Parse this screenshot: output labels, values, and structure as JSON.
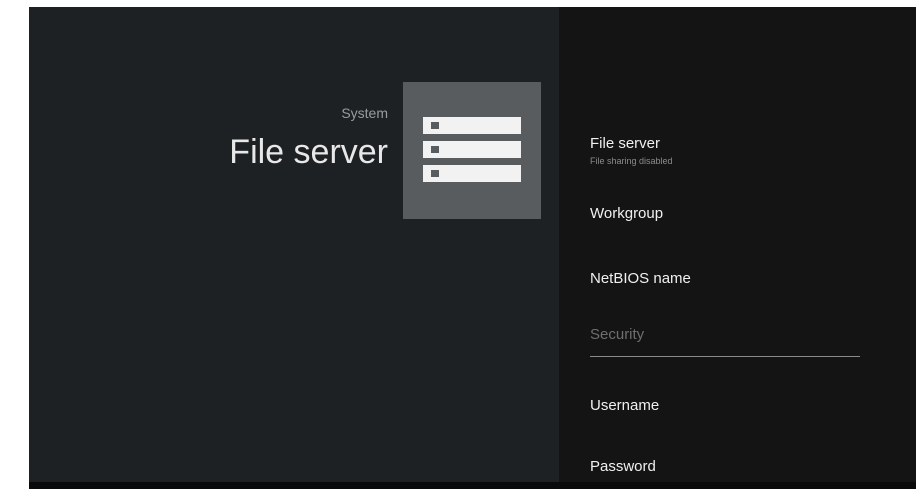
{
  "header": {
    "breadcrumb": "System",
    "title": "File server",
    "icon": "server-rack-icon"
  },
  "settings": {
    "items": [
      {
        "label": "File server",
        "sublabel": "File sharing disabled"
      },
      {
        "label": "Workgroup"
      },
      {
        "label": "NetBIOS name"
      }
    ],
    "security_section": {
      "header": "Security",
      "items": [
        {
          "label": "Username"
        },
        {
          "label": "Password"
        }
      ]
    }
  },
  "colors": {
    "left_background": "#1e2124",
    "right_background": "#141414",
    "icon_tile": "#595c5f",
    "primary_text": "#f0f0f0",
    "secondary_text": "#8c8c8c"
  }
}
